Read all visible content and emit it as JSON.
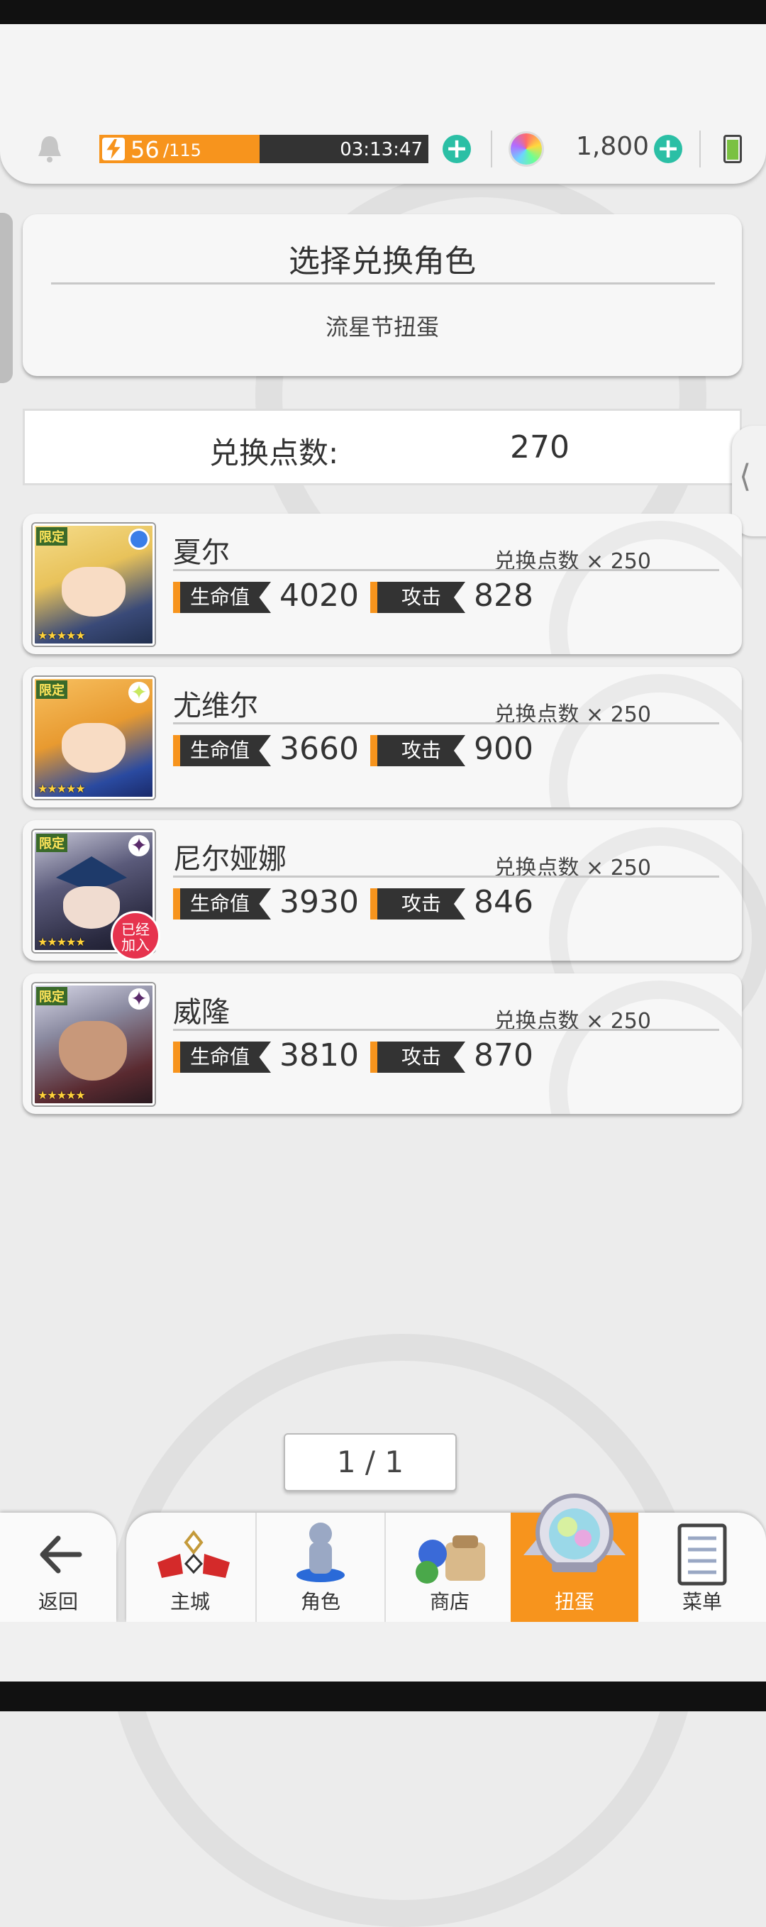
{
  "topbar": {
    "stamina_current": "56",
    "stamina_max": "/115",
    "timer": "03:13:47",
    "gems": "1,800"
  },
  "header": {
    "title": "选择兑换角色",
    "subtitle": "流星节扭蛋"
  },
  "points": {
    "label": "兑换点数:",
    "value": "270"
  },
  "labels": {
    "hp": "生命值",
    "atk": "攻击",
    "limited": "限定",
    "stars": "★★★★★",
    "joined": "已经加入"
  },
  "characters": [
    {
      "name": "夏尔",
      "cost": "兑换点数 × 250",
      "hp": "4020",
      "atk": "828",
      "element_color": "#3a7ee8"
    },
    {
      "name": "尤维尔",
      "cost": "兑换点数 × 250",
      "hp": "3660",
      "atk": "900",
      "element_color": "#c8e860"
    },
    {
      "name": "尼尔娅娜",
      "cost": "兑换点数 × 250",
      "hp": "3930",
      "atk": "846",
      "element_color": "#5a2a6a"
    },
    {
      "name": "威隆",
      "cost": "兑换点数 × 250",
      "hp": "3810",
      "atk": "870",
      "element_color": "#5a2a6a"
    }
  ],
  "pagination": "1 / 1",
  "nav": {
    "back": "返回",
    "items": [
      "主城",
      "角色",
      "商店",
      "扭蛋",
      "菜单"
    ],
    "active": "扭蛋",
    "accent": "#f7941d"
  },
  "colors": {
    "stamina": "#f7941d",
    "plus": "#2bbfa5",
    "stat_accent": "#f7941d",
    "joined_badge": "#e6334e"
  }
}
